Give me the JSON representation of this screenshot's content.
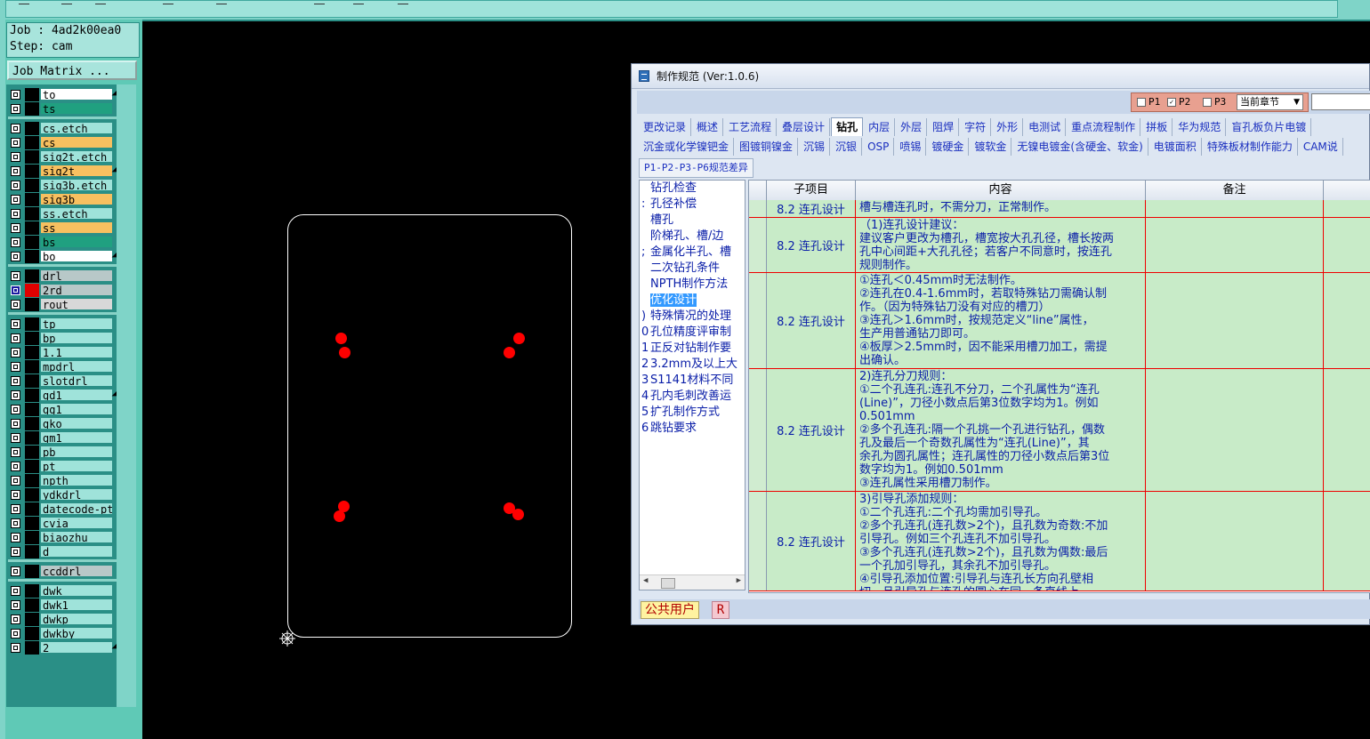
{
  "job": {
    "job_line": "Job : 4ad2k00ea0",
    "step_line": "Step: cam",
    "matrix_button": "Job Matrix ..."
  },
  "layers": [
    {
      "name": "to",
      "color": "#ffffff",
      "ptr": true
    },
    {
      "name": "ts",
      "color": "#20a080"
    },
    {
      "name": "cs.etch",
      "color": "#9fe3da"
    },
    {
      "name": "cs",
      "color": "#f7c060"
    },
    {
      "name": "sig2t.etch",
      "color": "#9fe3da"
    },
    {
      "name": "sig2t",
      "color": "#f7c060",
      "ptr": true
    },
    {
      "name": "sig3b.etch",
      "color": "#9fe3da"
    },
    {
      "name": "sig3b",
      "color": "#f7c060"
    },
    {
      "name": "ss.etch",
      "color": "#9fe3da"
    },
    {
      "name": "ss",
      "color": "#f7c060"
    },
    {
      "name": "bs",
      "color": "#20a080"
    },
    {
      "name": "bo",
      "color": "#ffffff",
      "ptr": true
    },
    {
      "name": "drl",
      "color": "#b8c8c8"
    },
    {
      "name": "2rd",
      "color": "#b8c8c8",
      "active": true
    },
    {
      "name": "rout",
      "color": "#d8d8d8"
    },
    {
      "name": "tp",
      "color": "#9fe3da"
    },
    {
      "name": "bp",
      "color": "#9fe3da"
    },
    {
      "name": "1.1",
      "color": "#9fe3da"
    },
    {
      "name": "mpdrl",
      "color": "#9fe3da"
    },
    {
      "name": "slotdrl",
      "color": "#9fe3da"
    },
    {
      "name": "gd1",
      "color": "#9fe3da",
      "ptr": true
    },
    {
      "name": "gg1",
      "color": "#9fe3da"
    },
    {
      "name": "gko",
      "color": "#9fe3da"
    },
    {
      "name": "gm1",
      "color": "#9fe3da"
    },
    {
      "name": "pb",
      "color": "#9fe3da"
    },
    {
      "name": "pt",
      "color": "#9fe3da"
    },
    {
      "name": "npth",
      "color": "#9fe3da"
    },
    {
      "name": "ydkdrl",
      "color": "#9fe3da"
    },
    {
      "name": "datecode-pte",
      "color": "#9fe3da"
    },
    {
      "name": "cvia",
      "color": "#9fe3da"
    },
    {
      "name": "biaozhu",
      "color": "#9fe3da"
    },
    {
      "name": "d",
      "color": "#9fe3da"
    },
    {
      "name": "ccddrl",
      "color": "#b8c8c8"
    },
    {
      "name": "dwk",
      "color": "#9fe3da"
    },
    {
      "name": "dwk1",
      "color": "#9fe3da"
    },
    {
      "name": "dwkp",
      "color": "#9fe3da"
    },
    {
      "name": "dwkby",
      "color": "#9fe3da"
    },
    {
      "name": "2",
      "color": "#9fe3da",
      "ptr": true
    }
  ],
  "dialog": {
    "title": "制作规范 (Ver:1.0.6)",
    "p_options": [
      {
        "label": "P1",
        "checked": false
      },
      {
        "label": "P2",
        "checked": true
      },
      {
        "label": "P3",
        "checked": false
      }
    ],
    "scope_select": "当前章节",
    "tabs_row1": [
      "更改记录",
      "概述",
      "工艺流程",
      "叠层设计",
      "钻孔",
      "内层",
      "外层",
      "阻焊",
      "字符",
      "外形",
      "电测试",
      "重点流程制作",
      "拼板",
      "华为规范",
      "盲孔板负片电镀"
    ],
    "active_tab": "钻孔",
    "tabs_row2": [
      "沉金或化学镍钯金",
      "图镀铜镍金",
      "沉锡",
      "沉银",
      "OSP",
      "喷锡",
      "镀硬金",
      "镀软金",
      "无镍电镀金(含硬金、软金)",
      "电镀面积",
      "特殊板材制作能力",
      "CAM说"
    ],
    "sub_tab": "P1-P2-P3-P6规范差异",
    "tree": [
      {
        "label": "钻孔检查"
      },
      {
        "label": "孔径补偿",
        "prefix": ":"
      },
      {
        "label": "槽孔"
      },
      {
        "label": "阶梯孔、槽/边"
      },
      {
        "label": "金属化半孔、槽",
        "prefix": ";"
      },
      {
        "label": "二次钻孔条件"
      },
      {
        "label": "NPTH制作方法"
      },
      {
        "label": "优化设计",
        "selected": true
      },
      {
        "label": "特殊情况的处理",
        "prefix": ")"
      },
      {
        "label": "孔位精度评审制",
        "prefix": "0"
      },
      {
        "label": "正反对钻制作要",
        "prefix": "1"
      },
      {
        "label": "3.2mm及以上大",
        "prefix": "2"
      },
      {
        "label": "S1141材料不同",
        "prefix": "3"
      },
      {
        "label": "孔内毛刺改善运",
        "prefix": "4"
      },
      {
        "label": "扩孔制作方式",
        "prefix": "5"
      },
      {
        "label": "跳钻要求",
        "prefix": "6"
      }
    ],
    "grid_headers": [
      "子项目",
      "内容",
      "备注"
    ],
    "rows": [
      {
        "sub": "8.2 连孔设计",
        "lines": [
          "槽与槽连孔时，不需分刀，正常制作。"
        ]
      },
      {
        "sub": "8.2 连孔设计",
        "lines": [
          "（1)连孔设计建议：",
          "建议客户更改为槽孔，槽宽按大孔孔径，槽长按两",
          "孔中心间距+大孔孔径；若客户不同意时，按连孔",
          "规则制作。"
        ]
      },
      {
        "sub": "8.2 连孔设计",
        "lines": [
          "①连孔＜0.45mm时无法制作。",
          "②连孔在0.4-1.6mm时，若取特殊钻刀需确认制",
          "作。（因为特殊钻刀没有对应的槽刀）",
          "③连孔＞1.6mm时，按规范定义“line”属性，",
          "生产用普通钻刀即可。",
          "④板厚＞2.5mm时，因不能采用槽刀加工，需提",
          "出确认。"
        ]
      },
      {
        "sub": "8.2 连孔设计",
        "lines": [
          "2)连孔分刀规则：",
          "①二个孔连孔:连孔不分刀，二个孔属性为“连孔",
          "(Line)”，刀径小数点后第3位数字均为1。例如",
          "0.501mm",
          "②多个孔连孔:隔一个孔挑一个孔进行钻孔，偶数",
          "孔及最后一个奇数孔属性为“连孔(Line)”，其",
          "余孔为圆孔属性；连孔属性的刀径小数点后第3位",
          "数字均为1。例如0.501mm",
          "③连孔属性采用槽刀制作。"
        ]
      },
      {
        "sub": "8.2 连孔设计",
        "lines": [
          "3)引导孔添加规则：",
          "①二个孔连孔:二个孔均需加引导孔。",
          "②多个孔连孔(连孔数>2个)，且孔数为奇数:不加",
          "引导孔。例如三个孔连孔不加引导孔。",
          "③多个孔连孔(连孔数>2个)，且孔数为偶数:最后",
          "一个孔加引导孔，其余孔不加引导孔。",
          "④引导孔添加位置:引导孔与连孔长方向孔壁相",
          "切，且引导孔与连孔的圆心在同一条直线上。"
        ]
      }
    ],
    "status_user": "公共用户",
    "status_r": "R"
  }
}
